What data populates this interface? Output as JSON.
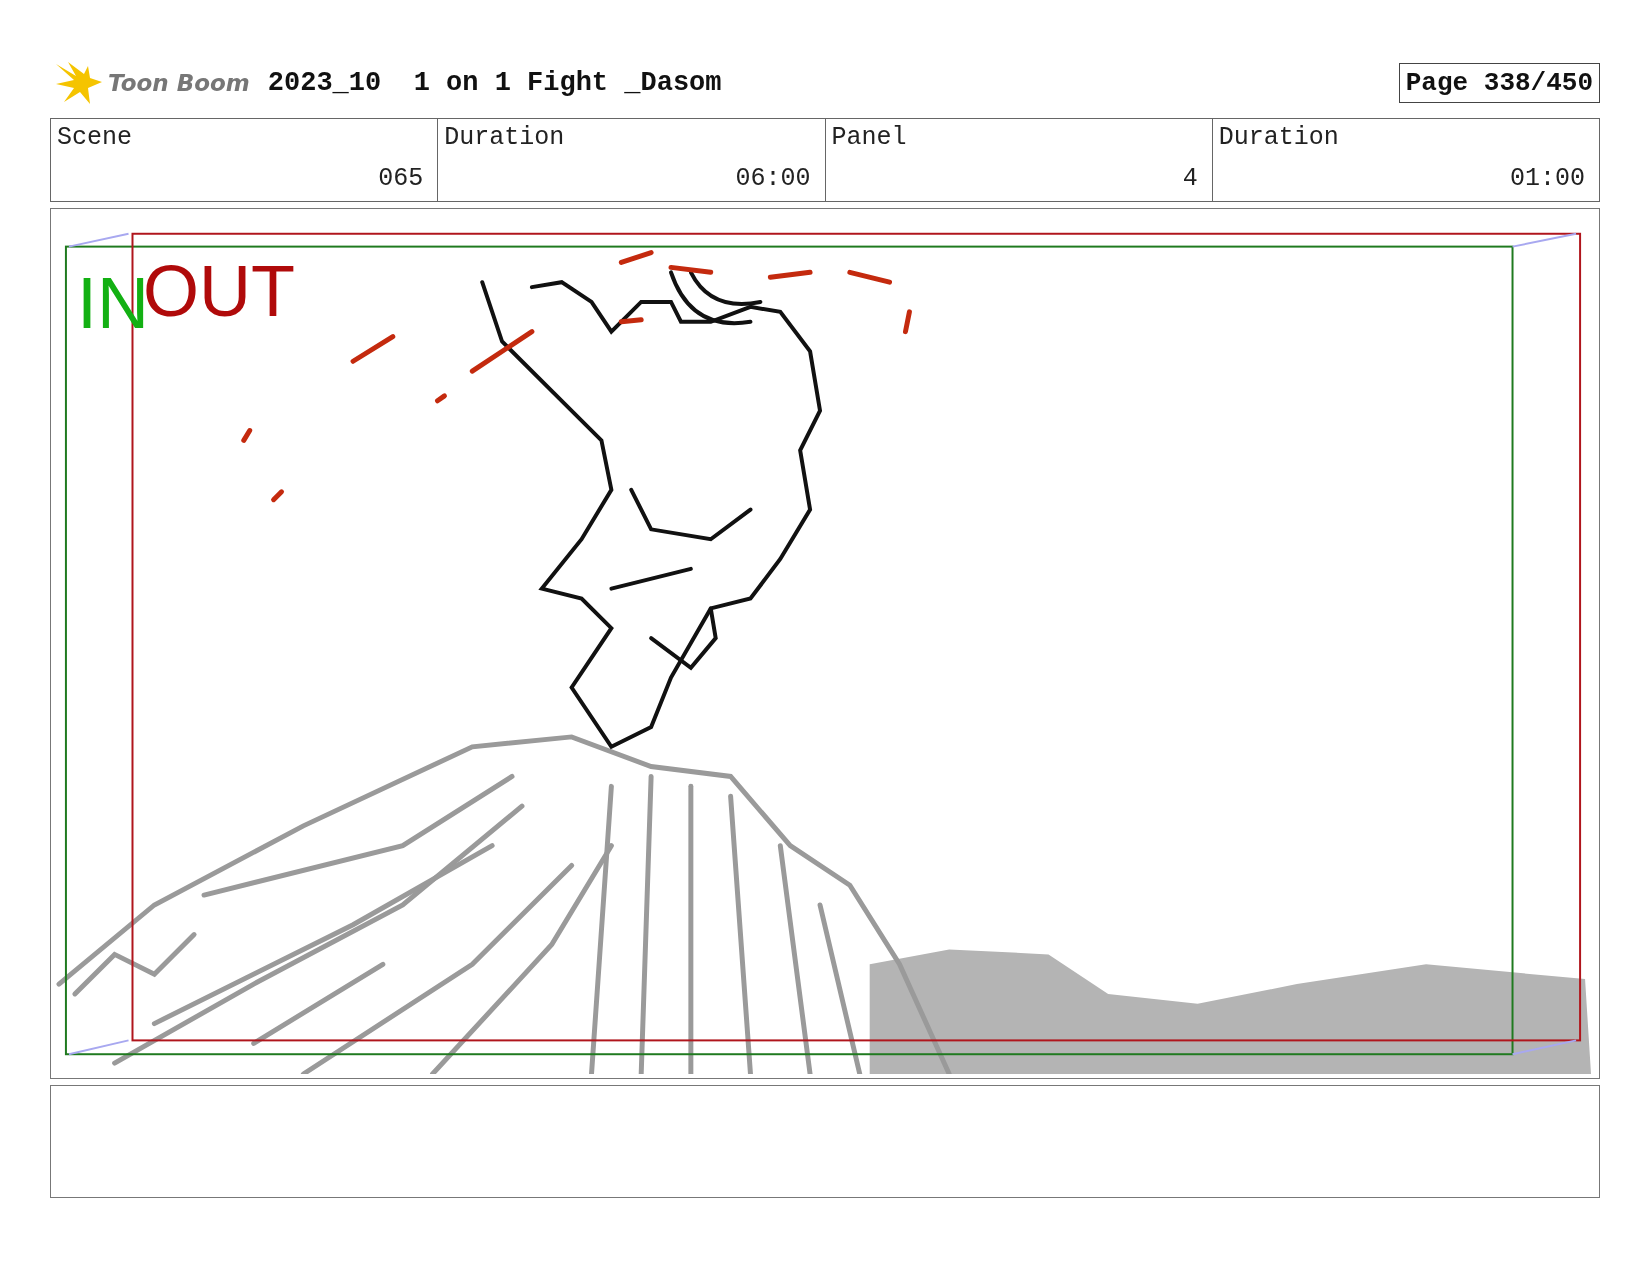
{
  "header": {
    "logo_text": "Toon Boom",
    "title": "2023_10  1 on 1 Fight _Dasom",
    "page": "Page 338/450"
  },
  "info_table": {
    "columns": [
      "Scene",
      "Duration",
      "Panel",
      "Duration"
    ],
    "rows": [
      [
        "065",
        "06:00",
        "4",
        "01:00"
      ]
    ]
  },
  "panel": {
    "in_label": "IN",
    "out_label": "OUT"
  }
}
